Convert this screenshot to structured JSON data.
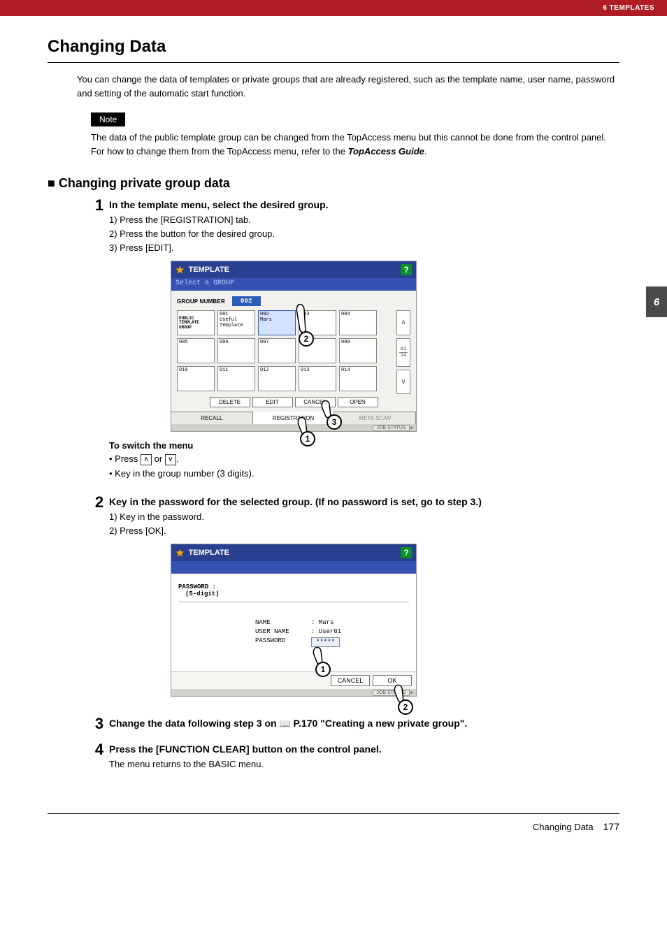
{
  "header": {
    "chapter_label": "6 TEMPLATES"
  },
  "title": "Changing Data",
  "intro": "You can change the data of templates or private groups that are already registered, such as the template name, user name, password and setting of the automatic start function.",
  "note": {
    "tag": "Note",
    "text_part1": "The data of the public template group can be changed from the TopAccess menu but this cannot be done from the control panel. For how to change them from the TopAccess menu, refer to the ",
    "text_guide": "TopAccess Guide",
    "text_part2": "."
  },
  "section_heading_prefix": "■",
  "section_heading": "Changing private group data",
  "steps": [
    {
      "num": "1",
      "title": "In the template menu, select the desired group.",
      "subs": [
        "1)  Press the [REGISTRATION] tab.",
        "2)  Press the button for the desired group.",
        "3)  Press [EDIT]."
      ],
      "after_fig_heading": "To switch the menu",
      "after_fig_bullets": [
        {
          "pre": "•  Press ",
          "k1": "∧",
          "mid": " or ",
          "k2": "∨",
          "post": "."
        },
        {
          "plain": "•  Key in the group number (3 digits)."
        }
      ]
    },
    {
      "num": "2",
      "title": "Key in the password for the selected group. (If no password is set, go to step 3.)",
      "subs": [
        "1)  Key in the password.",
        "2)  Press [OK]."
      ]
    },
    {
      "num": "3",
      "title_part1": "Change the data following step 3 on ",
      "title_ref": " P.170 \"Creating a new private group\".",
      "subs": []
    },
    {
      "num": "4",
      "title": "Press the [FUNCTION CLEAR] button on the control panel.",
      "after": "The menu returns to the BASIC menu."
    }
  ],
  "fig1": {
    "title": "TEMPLATE",
    "subtitle": "Select a GROUP",
    "group_number_label": "GROUP NUMBER",
    "group_number_value": "002",
    "public_label": "PUBLIC TEMPLATE GROUP",
    "cells": {
      "c001": "001",
      "c001_sub": "Useful Template",
      "c002": "002",
      "c002_sub": "Mars",
      "c003": "003",
      "c004": "004",
      "c005": "005",
      "c006": "006",
      "c007": "007",
      "c008": "008",
      "c009": "009",
      "c010": "010",
      "c011": "011",
      "c012": "012",
      "c013": "013",
      "c014": "014"
    },
    "page_cur": "01",
    "page_tot": "14",
    "btns": {
      "delete": "DELETE",
      "edit": "EDIT",
      "cancel": "CANCEL",
      "open": "OPEN"
    },
    "tabs": {
      "recall": "RECALL",
      "registration": "REGISTRATION",
      "meta": "META SCAN"
    },
    "job_status": "JOB STATUS",
    "callouts": {
      "c1": "1",
      "c2": "2",
      "c3": "3"
    }
  },
  "fig2": {
    "title": "TEMPLATE",
    "pw_label1": "PASSWORD :",
    "pw_label2": "(5-digit)",
    "name_label": "NAME",
    "name_val": ": Mars",
    "user_label": "USER NAME",
    "user_val": ": User01",
    "pass_label": "PASSWORD",
    "pass_val": "*****",
    "cancel": "CANCEL",
    "ok": "OK",
    "job_status": "JOB STATUS",
    "callouts": {
      "c1": "1",
      "c2": "2"
    }
  },
  "chapter_tab": "6",
  "footer": {
    "title": "Changing Data",
    "page": "177"
  }
}
